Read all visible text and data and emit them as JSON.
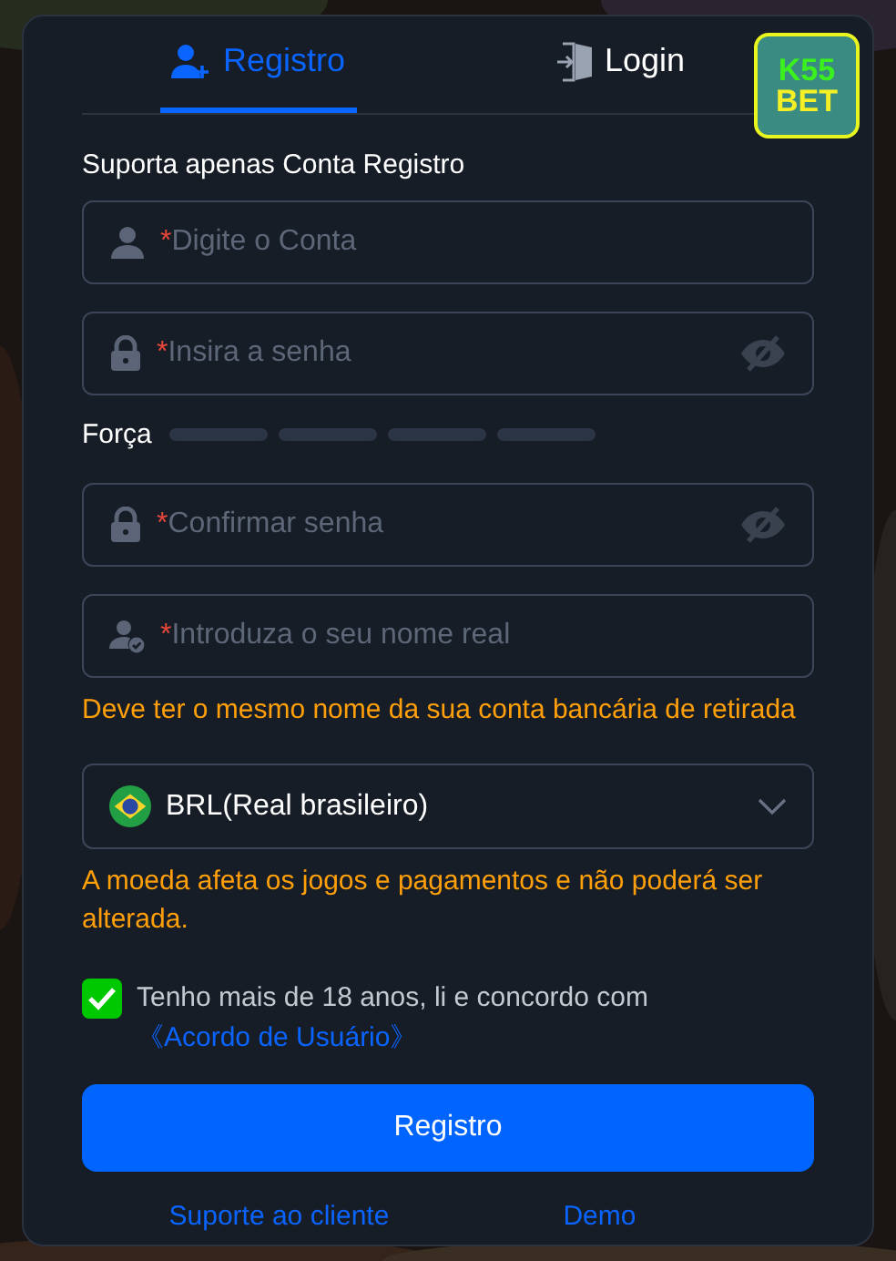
{
  "tabs": [
    {
      "label": "Registro",
      "selected": true
    },
    {
      "label": "Login",
      "selected": false
    }
  ],
  "logo": {
    "line_1": "K55",
    "line_2": "BET"
  },
  "heading": "Suporta apenas Conta Registro",
  "fields": [
    {
      "kind": "account",
      "mark": "*",
      "placeholder": "Digite o Conta"
    },
    {
      "kind": "password",
      "mark": "*",
      "placeholder": "Insira a senha"
    },
    {
      "kind": "strength",
      "label": "Força"
    },
    {
      "kind": "password",
      "mark": "*",
      "placeholder": "Confirmar senha"
    },
    {
      "kind": "real_name",
      "mark": "*",
      "placeholder": "Introduza o seu nome real"
    },
    {
      "kind": "note",
      "text": "Deve ter o mesmo nome da sua conta bancária de retirada"
    },
    {
      "kind": "select",
      "value": "BRL(Real brasileiro)"
    },
    {
      "kind": "note",
      "text": "A moeda afeta os jogos e pagamentos e não poderá ser alterada."
    }
  ],
  "agreement": {
    "checked": true,
    "text": "Tenho mais de 18 anos, li e concordo com",
    "link": "《Acordo de Usuário》"
  },
  "submit": "Registro",
  "footer_links": [
    "Suporte ao cliente",
    "Demo"
  ]
}
